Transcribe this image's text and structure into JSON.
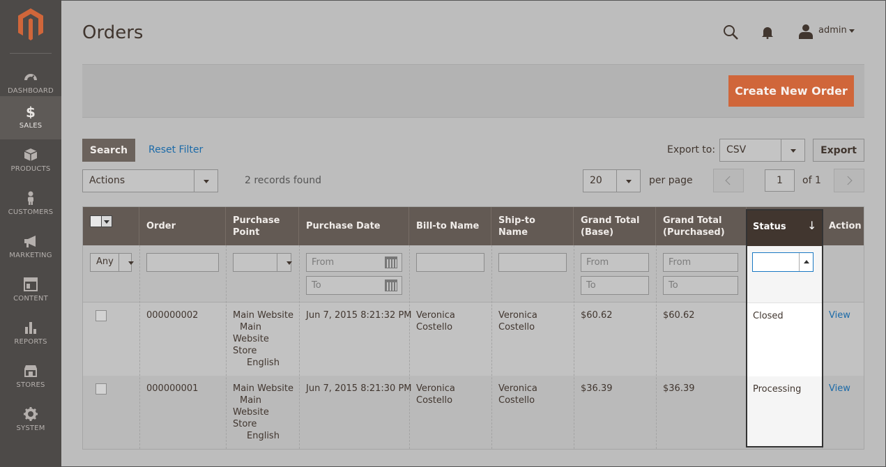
{
  "sidebar": {
    "items": [
      {
        "label": "DASHBOARD",
        "icon": "dashboard-icon"
      },
      {
        "label": "SALES",
        "icon": "dollar-icon",
        "active": true
      },
      {
        "label": "PRODUCTS",
        "icon": "box-icon"
      },
      {
        "label": "CUSTOMERS",
        "icon": "person-icon"
      },
      {
        "label": "MARKETING",
        "icon": "megaphone-icon"
      },
      {
        "label": "CONTENT",
        "icon": "layout-icon"
      },
      {
        "label": "REPORTS",
        "icon": "bar-chart-icon"
      },
      {
        "label": "STORES",
        "icon": "storefront-icon"
      },
      {
        "label": "SYSTEM",
        "icon": "gear-icon"
      }
    ]
  },
  "header": {
    "title": "Orders",
    "user": "admin"
  },
  "toolbar": {
    "create_label": "Create New Order",
    "search_label": "Search",
    "reset_label": "Reset Filter",
    "export_to_label": "Export to:",
    "export_format": "CSV",
    "export_label": "Export",
    "actions_label": "Actions",
    "records_found": "2 records found",
    "per_page_value": "20",
    "per_page_label": "per page",
    "page_value": "1",
    "page_of": "of 1"
  },
  "grid": {
    "columns": {
      "order": "Order",
      "purchase_point": [
        "Purchase",
        "Point"
      ],
      "purchase_date": "Purchase Date",
      "bill_to": "Bill-to Name",
      "ship_to": [
        "Ship-to",
        "Name"
      ],
      "grand_base": [
        "Grand Total",
        "(Base)"
      ],
      "grand_purchased": [
        "Grand Total",
        "(Purchased)"
      ],
      "status": "Status",
      "status_sort": "↓",
      "action": "Action"
    },
    "filters": {
      "any": "Any",
      "from": "From",
      "to": "To"
    },
    "rows": [
      {
        "order": "000000002",
        "purchase_point": [
          "Main Website",
          "Main",
          "Website",
          "Store",
          "English"
        ],
        "purchase_date": "Jun 7, 2015 8:21:32 PM",
        "bill_to": [
          "Veronica",
          "Costello"
        ],
        "ship_to": [
          "Veronica",
          "Costello"
        ],
        "grand_base": "$60.62",
        "grand_purchased": "$60.62",
        "status": "Closed",
        "action": "View"
      },
      {
        "order": "000000001",
        "purchase_point": [
          "Main Website",
          "Main",
          "Website",
          "Store",
          "English"
        ],
        "purchase_date": "Jun 7, 2015 8:21:30 PM",
        "bill_to": [
          "Veronica",
          "Costello"
        ],
        "ship_to": [
          "Veronica",
          "Costello"
        ],
        "grand_base": "$36.39",
        "grand_purchased": "$36.39",
        "status": "Processing",
        "action": "View"
      }
    ]
  },
  "colors": {
    "sidebar": "#4d4a48",
    "accent": "#d0663a",
    "header_dark": "#635a54",
    "link": "#1b6aa8"
  }
}
